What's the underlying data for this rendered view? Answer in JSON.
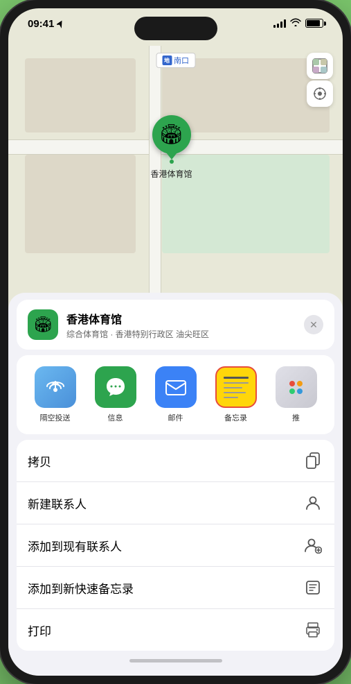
{
  "status": {
    "time": "09:41",
    "location_arrow": "▶"
  },
  "map": {
    "label_icon": "地",
    "label_text": "南口",
    "control_map_icon": "⊞",
    "control_location_icon": "◎",
    "pin_label": "香港体育馆",
    "pin_emoji": "🏟"
  },
  "venue": {
    "name": "香港体育馆",
    "subtitle": "综合体育馆 · 香港特别行政区 油尖旺区",
    "icon_emoji": "🏟",
    "close_icon": "✕"
  },
  "share_items": [
    {
      "id": "airdrop",
      "label": "隔空投送",
      "emoji": "📡"
    },
    {
      "id": "messages",
      "label": "信息",
      "emoji": "💬"
    },
    {
      "id": "mail",
      "label": "邮件",
      "emoji": "✉"
    },
    {
      "id": "notes",
      "label": "备忘录",
      "emoji": ""
    },
    {
      "id": "more",
      "label": "推",
      "emoji": ""
    }
  ],
  "actions": [
    {
      "id": "copy",
      "label": "拷贝",
      "icon": "copy"
    },
    {
      "id": "new-contact",
      "label": "新建联系人",
      "icon": "person"
    },
    {
      "id": "add-existing",
      "label": "添加到现有联系人",
      "icon": "person-add"
    },
    {
      "id": "add-notes",
      "label": "添加到新快速备忘录",
      "icon": "note"
    },
    {
      "id": "print",
      "label": "打印",
      "icon": "print"
    }
  ]
}
